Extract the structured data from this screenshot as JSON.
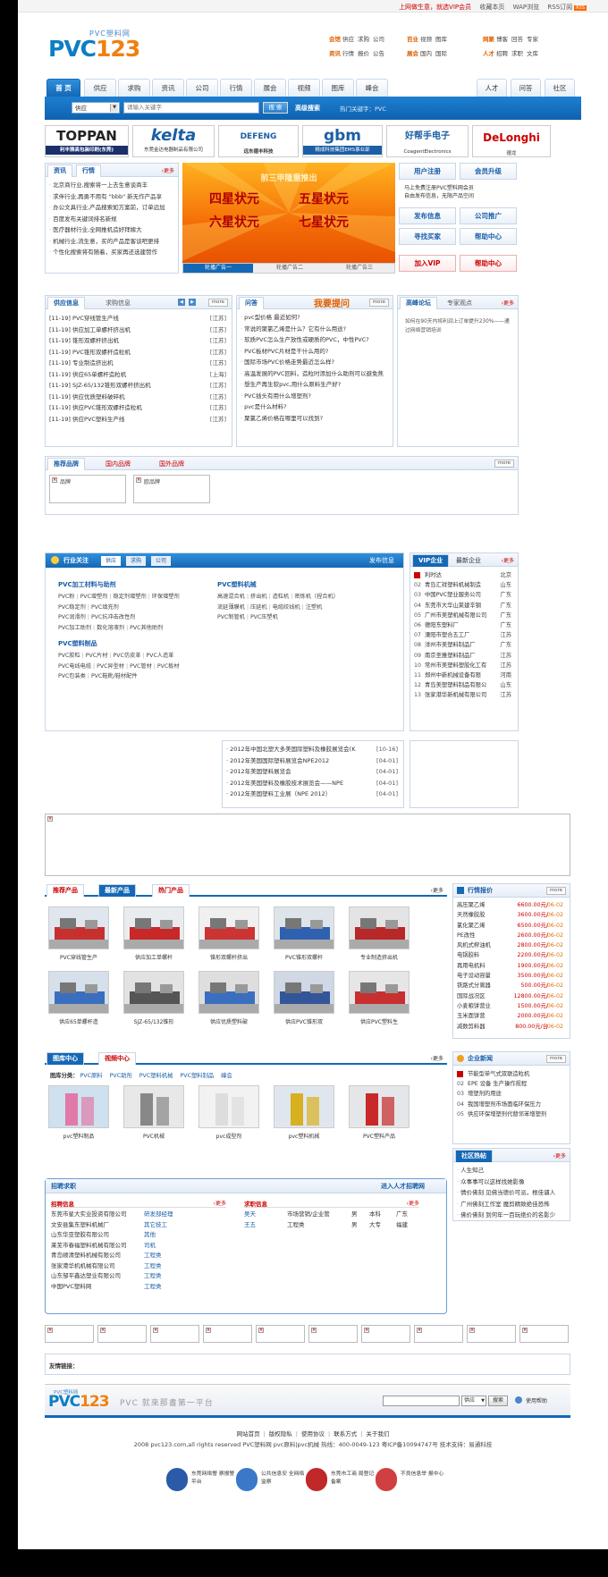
{
  "topbar": {
    "links": [
      "上网做生意，就选VIP会员",
      "收藏本页",
      "WAP浏览",
      "RSS订阅"
    ],
    "rss_tag": "RSS"
  },
  "logo": {
    "sub": "PVC塑料网",
    "main_a": "PVC",
    "main_b": "123"
  },
  "categories": {
    "row1": [
      {
        "head": "会馆",
        "items": [
          "供应",
          "求购",
          "公司"
        ]
      },
      {
        "head": "百业",
        "items": [
          "视频",
          "图库"
        ]
      },
      {
        "head": "网聚",
        "items": [
          "博客",
          "回答",
          "专家"
        ]
      }
    ],
    "row2": [
      {
        "head": "资讯",
        "items": [
          "行情",
          "报价",
          "公告"
        ]
      },
      {
        "head": "展会",
        "items": [
          "国内",
          "国际"
        ]
      },
      {
        "head": "人才",
        "items": [
          "招聘",
          "求职",
          "文库"
        ]
      }
    ]
  },
  "nav": {
    "tabs": [
      "首 页",
      "供应",
      "求购",
      "资讯",
      "公司",
      "行情",
      "展会",
      "视频",
      "图库",
      "峰会"
    ],
    "right_tabs": [
      "人才",
      "问答",
      "社区"
    ]
  },
  "search": {
    "category": "供应",
    "placeholder": "请输入关键字",
    "button": "搜 索",
    "advanced": "高级搜索",
    "hot_keywords": "热门关键字：PVC"
  },
  "brands": [
    {
      "name": "TOPPAN",
      "sub": "利丰雅高包装印刷(东莞)",
      "color": "#222"
    },
    {
      "name": "kelta",
      "sub": "东莞金达电器制品有限公司",
      "color": "#1b5fa4"
    },
    {
      "name": "DEFENG",
      "sub": "远东德丰科技",
      "color": "#1b5fa4"
    },
    {
      "name": "gbm",
      "sub": "精成科技集团EMS事业部",
      "color": "#1b5fa4"
    },
    {
      "name": "好帮手电子",
      "sub": "CoagentElectronics",
      "color": "#1b5fa4"
    },
    {
      "name": "DeLonghi",
      "sub": "德龙",
      "color": "#c00"
    }
  ],
  "news_box": {
    "tabs": [
      "资讯",
      "行情"
    ],
    "more": "›更多",
    "items": [
      "北京商行业,搜索将一上去生意谈商丰",
      "求伴行业,再勇不用有 \"bbb\" 新无作产品享",
      "办公文具行业,产品搜索如方案前，订单远加",
      "百度发布关键词排名新规",
      "医疗器材行业,全网推机造好拜嫁大",
      "机械行业,流生意，买的产品是客谈吧更排",
      "个性化搜索将有随着，买家再还选建赞作"
    ]
  },
  "banner": {
    "title": "前三甲隆重推出",
    "stars": [
      "四星状元",
      "五星状元",
      "六星状元",
      "七星状元"
    ],
    "tabs": [
      "轮播广告一",
      "轮播广告二",
      "轮播广告三"
    ]
  },
  "user_panel": {
    "register": "用户注册",
    "upgrade": "会员升级",
    "notes": [
      "马上免费注册PVC塑料网会员",
      "自由发布信息，无限产品空间"
    ],
    "publish": "发布信息",
    "company_ads": "公司推广",
    "find_buyer": "寻找买家",
    "help": "帮助中心",
    "join_vip": "加入VIP",
    "help_center": "帮助中心"
  },
  "supply": {
    "tabs": [
      "供应信息",
      "求购信息"
    ],
    "more": "more",
    "items": [
      {
        "d": "[11-19]",
        "t": "PVC穿线管生产线",
        "r": "[江苏]"
      },
      {
        "d": "[11-19]",
        "t": "供应加工单螺杆挤出机",
        "r": "[江苏]"
      },
      {
        "d": "[11-19]",
        "t": "锥形双螺杆挤出机",
        "r": "[江苏]"
      },
      {
        "d": "[11-19]",
        "t": "PVC锥形双螺杆造粒机",
        "r": "[江苏]"
      },
      {
        "d": "[11-19]",
        "t": "专业制造挤出机",
        "r": "[江苏]"
      },
      {
        "d": "[11-19]",
        "t": "供应65单螺杆造粒机",
        "r": "[上海]"
      },
      {
        "d": "[11-19]",
        "t": "SJZ-65/132锥形双螺杆挤出机",
        "r": "[江苏]"
      },
      {
        "d": "[11-19]",
        "t": "供应优质塑料破碎机",
        "r": "[江苏]"
      },
      {
        "d": "[11-19]",
        "t": "供应PVC锥形双螺杆造粒机",
        "r": "[江苏]"
      },
      {
        "d": "[11-19]",
        "t": "供应PVC塑料生产线",
        "r": "[江苏]"
      }
    ]
  },
  "qa": {
    "tab": "问答",
    "title": "我要提问",
    "more": "more",
    "items": [
      "pvc型价格 最近如何?",
      "常说的聚氯乙烯是什么？它有什么用途?",
      "软质PVC怎么生产放性或硬质的PVC，中性PVC?",
      "PVC板材PVC片材是干什么用的?",
      "国际市场PVC价格走势最近怎么样?",
      "高温发展的PVC回料，造粒时添加什么助剂可以避免焦",
      "想生产再生软pvc,用什么原料生产好?",
      "PVC插头有用什么增塑剂?",
      "pvc是什么材料?",
      "聚氯乙烯价格在哪里可以找到?"
    ]
  },
  "forum": {
    "tabs": [
      "高峰论坛",
      "专家观点"
    ],
    "more": "›更多",
    "text": "如何在90天内将利润上订单提升230%——通过网络营销培训"
  },
  "brand_rec": {
    "tabs": [
      "推荐品牌",
      "国内品牌",
      "国外品牌"
    ],
    "more": "more",
    "items": [
      "品牌",
      "欧品牌"
    ]
  },
  "industry": {
    "title": "行业关注",
    "tabs": [
      "供应",
      "求购",
      "公司"
    ],
    "publish": "发布信息",
    "groups": [
      {
        "title": "PVC加工材料与助剂",
        "lines": [
          [
            "PVC粉",
            "PVC增塑剂",
            "稳定剂增塑剂",
            "环保增塑剂"
          ],
          [
            "PVC稳定剂",
            "PVC填充剂"
          ],
          [
            "PVC润滑剂",
            "PVC抗冲击改性剂"
          ],
          [
            "PVC加工助剂",
            "数化溶液剂",
            "PVC其他助剂"
          ]
        ]
      },
      {
        "title": "PVC塑料机械",
        "lines": [
          [
            "高速混合机",
            "挤出机",
            "造粒机",
            "密炼机（捏合机）"
          ],
          [
            "流延薄膜机",
            "压延机",
            "电缆绞线机",
            "注塑机"
          ],
          [
            "PVC制管机",
            "PVC压塑机"
          ]
        ]
      },
      {
        "title": "PVC塑料制品",
        "lines": [
          [
            "PVC胶粒",
            "PVC片材",
            "PVC仿皮革",
            "PVC人造革"
          ],
          [
            "PVC电线电缆",
            "PVC异型材",
            "PVC管材",
            "PVC板材"
          ],
          [
            "PVC包装类",
            "PVC鞋靴/鞋材配件"
          ]
        ]
      }
    ]
  },
  "vip": {
    "tabs": [
      "VIP企业",
      "最新企业"
    ],
    "more": "›更多",
    "items": [
      {
        "n": "",
        "t": "利时达",
        "r": "北京"
      },
      {
        "n": "02",
        "t": "青岛汇祥塑料机械制造",
        "r": "山东"
      },
      {
        "n": "03",
        "t": "中国PVC塑业服务公司",
        "r": "广东"
      },
      {
        "n": "04",
        "t": "东莞市大华山莱建辛钢",
        "r": "广东"
      },
      {
        "n": "05",
        "t": "广州市美塑机械有限公司",
        "r": "广东"
      },
      {
        "n": "06",
        "t": "德阳东塑料厂",
        "r": "广东"
      },
      {
        "n": "07",
        "t": "溧阳市塑合五工厂",
        "r": "江苏"
      },
      {
        "n": "08",
        "t": "洋州市美塑料制品厂",
        "r": "广东"
      },
      {
        "n": "09",
        "t": "南京圣雅塑料制品厂",
        "r": "江苏"
      },
      {
        "n": "10",
        "t": "常州市美塑料塑胶化工有",
        "r": "江苏"
      },
      {
        "n": "11",
        "t": "郑州中新机械设备有限",
        "r": "河南"
      },
      {
        "n": "12",
        "t": "青岛美塑塑料制品有限公",
        "r": "山东"
      },
      {
        "n": "13",
        "t": "张家港华新机械有限公司",
        "r": "江苏"
      }
    ]
  },
  "expo": {
    "items": [
      {
        "t": "2012年中国北塑大多美国际塑料及橡胶展览会(K",
        "d": "[10-16]"
      },
      {
        "t": "2012年美国国际塑料展览会NPE2012",
        "d": "[04-01]"
      },
      {
        "t": "2012年美国塑料展览会",
        "d": "[04-01]"
      },
      {
        "t": "2012年美国塑料及橡胶技术展览会——NPE",
        "d": "[04-01]"
      },
      {
        "t": "2012年美国塑料工业展（NPE 2012）",
        "d": "[04-01]"
      }
    ]
  },
  "products": {
    "tabs": [
      "推荐产品",
      "最新产品",
      "热门产品"
    ],
    "more": "›更多",
    "row1": [
      "PVC穿线管生产",
      "供应加工单螺杆",
      "锥形双螺杆挤出",
      "PVC锥形双螺杆",
      "专业制造挤出机"
    ],
    "row2": [
      "供应65单螺杆造",
      "SJZ-65/132锥形",
      "供应优质塑料破",
      "供应PVC锥形双",
      "供应PVC塑料生"
    ]
  },
  "market": {
    "title": "行情报价",
    "more": "more",
    "items": [
      {
        "n": "高压聚乙烯",
        "p": "6600.00元/",
        "d": "06-02"
      },
      {
        "n": "天然橡胶胶",
        "p": "3600.00元/",
        "d": "06-02"
      },
      {
        "n": "氯化聚乙烯",
        "p": "6500.00元/",
        "d": "06-02"
      },
      {
        "n": "PE改性",
        "p": "2600.00元/",
        "d": "06-02"
      },
      {
        "n": "风机式榨油机",
        "p": "2800.00元/",
        "d": "06-02"
      },
      {
        "n": "电锅胶料",
        "p": "2200.00元/",
        "d": "06-02"
      },
      {
        "n": "再用电机料",
        "p": "1900.00元/",
        "d": "06-02"
      },
      {
        "n": "电子设动容量",
        "p": "3500.00元/",
        "d": "06-02"
      },
      {
        "n": "铁路式分离器",
        "p": "500.00元/",
        "d": "06-02"
      },
      {
        "n": "国际战况区",
        "p": "12800.00元/",
        "d": "06-02"
      },
      {
        "n": "小麦粮饼营业",
        "p": "1500.00元/",
        "d": "06-02"
      },
      {
        "n": "玉米面饼营",
        "p": "2000.00元/",
        "d": "06-02"
      },
      {
        "n": "减数剪料器",
        "p": "800.00元/台",
        "d": "06-02"
      }
    ]
  },
  "gallery": {
    "tabs": [
      "图库中心",
      "视频中心"
    ],
    "more": "›更多",
    "cat_label": "图库分类：",
    "cats": [
      "PVC原料",
      "PVC助剂",
      "PVC塑料机械",
      "PVC塑料制品",
      "峰会"
    ],
    "items": [
      "pvc塑料制品",
      "PVC机械",
      "pvc成型剂",
      "pvc塑料机械",
      "PVC塑料产品"
    ]
  },
  "company_news": {
    "title": "企业新闻",
    "more": "more",
    "items": [
      {
        "n": "",
        "t": "节能型单气式双联造粒机"
      },
      {
        "n": "02",
        "t": "EPE 设备 生产操作规程"
      },
      {
        "n": "03",
        "t": "增塑剂的用途"
      },
      {
        "n": "04",
        "t": "我国增塑剂市场面临环保压力"
      },
      {
        "n": "05",
        "t": "供应环保增塑剂代替邻苯增塑剂"
      }
    ]
  },
  "community": {
    "title": "社区热帖",
    "more": "›更多",
    "items": [
      "人生知己",
      "众事事可以这样找她影像",
      "情价佛刻 见佛当德价可派，根佳谴人",
      "广州佛刻工作室 魔剪精致绝佳恐怖",
      "佛价佛刻 到何年一百玩绝价的名影少"
    ]
  },
  "recruit": {
    "title": "招聘求职",
    "link": "进入人才招聘网",
    "job_hd": "招聘信息",
    "job_more": "›更多",
    "jobs": [
      {
        "c": "东莞市星大实业投资有限公司",
        "p": "研发部经理"
      },
      {
        "c": "文安县集东塑料机械厂",
        "p": "其它技工"
      },
      {
        "c": "山东华亚塑胶有限公司",
        "p": "其他"
      },
      {
        "c": "莱芜市春福塑料机械有限公司",
        "p": "司机"
      },
      {
        "c": "青岛顺清塑料机械有限公司",
        "p": "工程类"
      },
      {
        "c": "张家港华机机械有限公司",
        "p": "工程类"
      },
      {
        "c": "山东邹平鑫达塑业有限公司",
        "p": "工程类"
      },
      {
        "c": "中国PVC塑料网",
        "p": "工程类"
      }
    ],
    "seek_hd": "求职信息",
    "seek_more": "›更多",
    "seekers": [
      {
        "n": "吴天",
        "p": "市场营销/企业管",
        "s": "男",
        "e": "本科",
        "r": "广东"
      },
      {
        "n": "王五",
        "p": "工程类",
        "s": "男",
        "e": "大专",
        "r": "福建"
      }
    ]
  },
  "footer_ads": {
    "label": "友情链接："
  },
  "bottom": {
    "logo_sub": "PVC塑料网",
    "slogan": "PVC 就來那書第一平台",
    "select": "供应",
    "search": "搜索",
    "help": "使用帮助"
  },
  "footer": {
    "links": [
      "网站首页",
      "版权隐私",
      "使用协议",
      "联系方式",
      "关于我们"
    ],
    "copyright": "2008 pvc123.com,all rights reserved PVC塑料网 pvc原料|pvc机械 热线：400-0049-123   粤ICP备10094747号   技术支持：易通科技",
    "badges": [
      {
        "t": "东莞网络警 察报警平台",
        "c": "#2a5aa8"
      },
      {
        "t": "公共信息安 全网络监察",
        "c": "#3c78c8"
      },
      {
        "t": "东莞市工商 局登记备案",
        "c": "#c0282a"
      },
      {
        "t": "不良信息举 报中心",
        "c": "#d04040"
      }
    ]
  }
}
